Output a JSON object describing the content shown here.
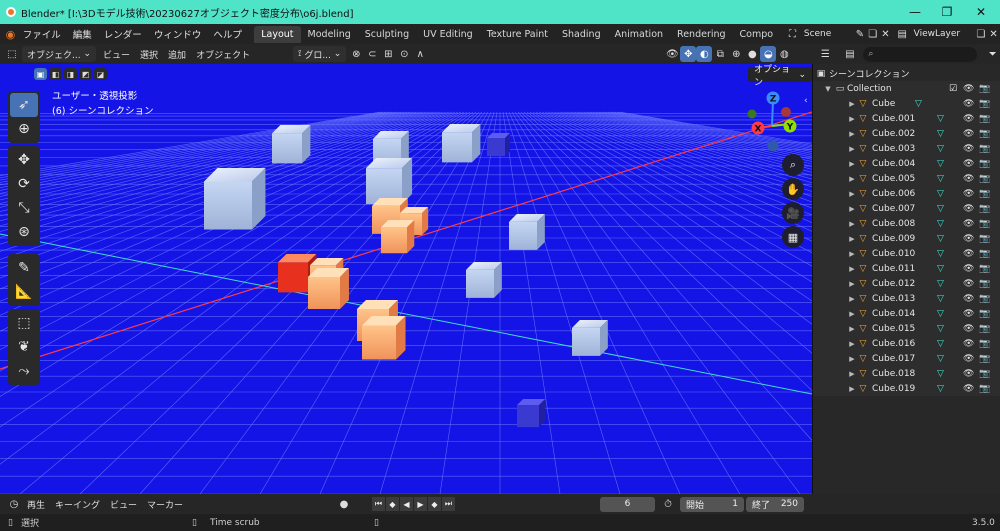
{
  "window": {
    "title": "Blender* [I:\\3Dモデル技術\\20230627オブジェクト密度分布\\o6j.blend]",
    "minimize": "—",
    "maximize": "❐",
    "close": "✕"
  },
  "menu": [
    "ファイル",
    "編集",
    "レンダー",
    "ウィンドウ",
    "ヘルプ"
  ],
  "workspaces": [
    "Layout",
    "Modeling",
    "Sculpting",
    "UV Editing",
    "Texture Paint",
    "Shading",
    "Animation",
    "Rendering",
    "Compo"
  ],
  "active_workspace": "Layout",
  "scene_name": "Scene",
  "view_layer_name": "ViewLayer",
  "viewport_header": {
    "mode": "オブジェク...",
    "view": "ビュー",
    "select": "選択",
    "add": "追加",
    "object": "オブジェクト",
    "transform_orientation": "グロ...",
    "options": "オプション"
  },
  "viewport_overlay": {
    "line1": "ユーザー・透視投影",
    "line2": "(6) シーンコレクション"
  },
  "gizmo": {
    "x": "X",
    "y": "Y",
    "z": "Z"
  },
  "outliner": {
    "root": "シーンコレクション",
    "collection": "Collection",
    "objects": [
      "Cube",
      "Cube.001",
      "Cube.002",
      "Cube.003",
      "Cube.004",
      "Cube.005",
      "Cube.006",
      "Cube.007",
      "Cube.008",
      "Cube.009",
      "Cube.010",
      "Cube.011",
      "Cube.012",
      "Cube.013",
      "Cube.014",
      "Cube.015",
      "Cube.016",
      "Cube.017",
      "Cube.018",
      "Cube.019"
    ]
  },
  "timeline": {
    "playback": "再生",
    "keying": "キーイング",
    "view": "ビュー",
    "marker": "マーカー",
    "current_frame": "6",
    "start_label": "開始",
    "start": "1",
    "end_label": "終了",
    "end": "250"
  },
  "status": {
    "select": "選択",
    "time_scrub": "Time scrub",
    "version": "3.5.0"
  },
  "colors": {
    "viewport_bg": "#1414e6",
    "titlebar": "#4fe3c8",
    "accent": "#4772b3",
    "object_icon": "#f2a33a",
    "mesh_icon": "#3ee0d0"
  }
}
